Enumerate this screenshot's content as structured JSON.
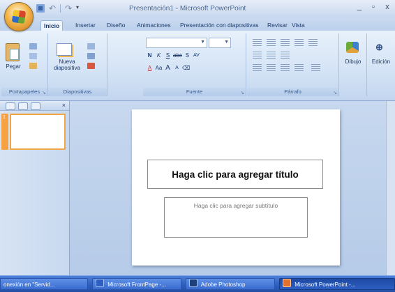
{
  "window": {
    "title": "Presentación1 - Microsoft PowerPoint",
    "controls": {
      "minimize": "_",
      "maximize": "▫",
      "close": "x"
    }
  },
  "ribbon": {
    "tabs": [
      {
        "label": "Inicio",
        "active": true
      },
      {
        "label": "Insertar",
        "active": false
      },
      {
        "label": "Diseño",
        "active": false
      },
      {
        "label": "Animaciones",
        "active": false
      },
      {
        "label": "Presentación con diapositivas",
        "active": false
      },
      {
        "label": "Revisar",
        "active": false
      },
      {
        "label": "Vista",
        "active": false
      }
    ],
    "groups": {
      "clipboard": {
        "label": "Portapapeles",
        "paste_label": "Pegar"
      },
      "slides": {
        "label": "Diapositivas",
        "new_slide_label": "Nueva diapositiva"
      },
      "font": {
        "label": "Fuente",
        "font_name": "",
        "font_size": "",
        "bold": "N",
        "italic": "K",
        "underline": "S",
        "strike": "abc",
        "shadow": "S",
        "spacing": "AV",
        "change_case": "Aa",
        "font_color": "A",
        "grow": "A",
        "shrink": "A"
      },
      "paragraph": {
        "label": "Párrafo"
      },
      "drawing": {
        "label": "Dibujo"
      },
      "editing": {
        "label": "Edición"
      }
    }
  },
  "slides_pane": {
    "slide_number": "1"
  },
  "slide": {
    "title_placeholder": "Haga clic para agregar título",
    "subtitle_placeholder": "Haga clic para agregar subtítulo"
  },
  "taskbar": {
    "items": [
      {
        "label": "onexión en \"Servid...",
        "icon": "network-icon"
      },
      {
        "label": "Microsoft FrontPage -...",
        "icon": "frontpage-icon"
      },
      {
        "label": "Adobe Photoshop",
        "icon": "photoshop-icon"
      },
      {
        "label": "Microsoft PowerPoint -...",
        "icon": "powerpoint-icon",
        "active": true
      }
    ]
  }
}
